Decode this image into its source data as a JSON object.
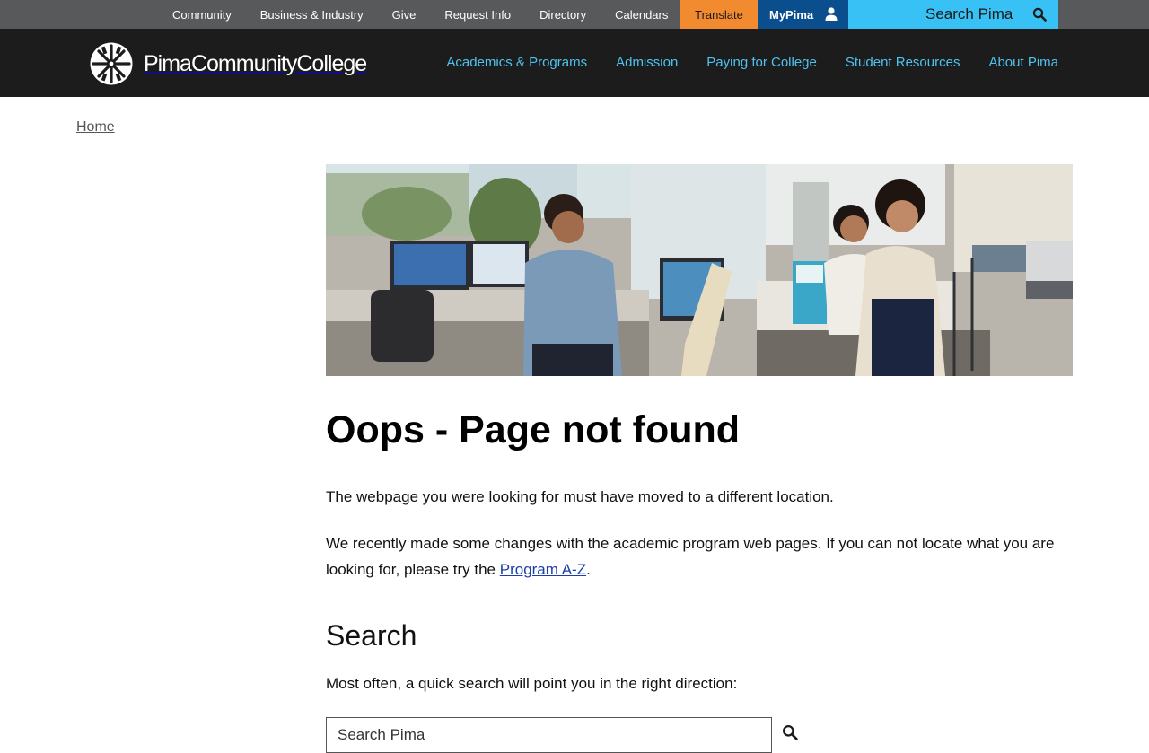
{
  "utility": {
    "links": [
      "Community",
      "Business & Industry",
      "Give",
      "Request Info",
      "Directory",
      "Calendars"
    ],
    "translate": "Translate",
    "mypima": "MyPima",
    "search_placeholder": "Search Pima"
  },
  "header": {
    "logo_text": "PimaCommunityCollege",
    "nav": [
      "Academics & Programs",
      "Admission",
      "Paying for College",
      "Student Resources",
      "About Pima"
    ]
  },
  "breadcrumb": {
    "home": "Home"
  },
  "content": {
    "title": "Oops - Page not found",
    "para1": "The webpage you were looking for must have moved to a different location.",
    "para2_before": "We recently made some changes with the academic program web pages. If you can not locate what you are looking for, please try the ",
    "para2_link": "Program A-Z",
    "para2_after": ".",
    "search_heading": "Search",
    "search_intro": "Most often, a quick search will point you in the right direction:",
    "search_placeholder": "Search Pima"
  },
  "icons": {
    "user": "user-icon",
    "search": "search-icon",
    "logo": "pima-logo-icon"
  },
  "colors": {
    "utility_bg": "#58595b",
    "translate_bg": "#f28b30",
    "mypima_bg": "#0b4e8d",
    "search_bg": "#38c1f5",
    "header_bg": "#1c1c1c",
    "nav_link": "#4ec3f0",
    "link": "#1a3ea8"
  }
}
